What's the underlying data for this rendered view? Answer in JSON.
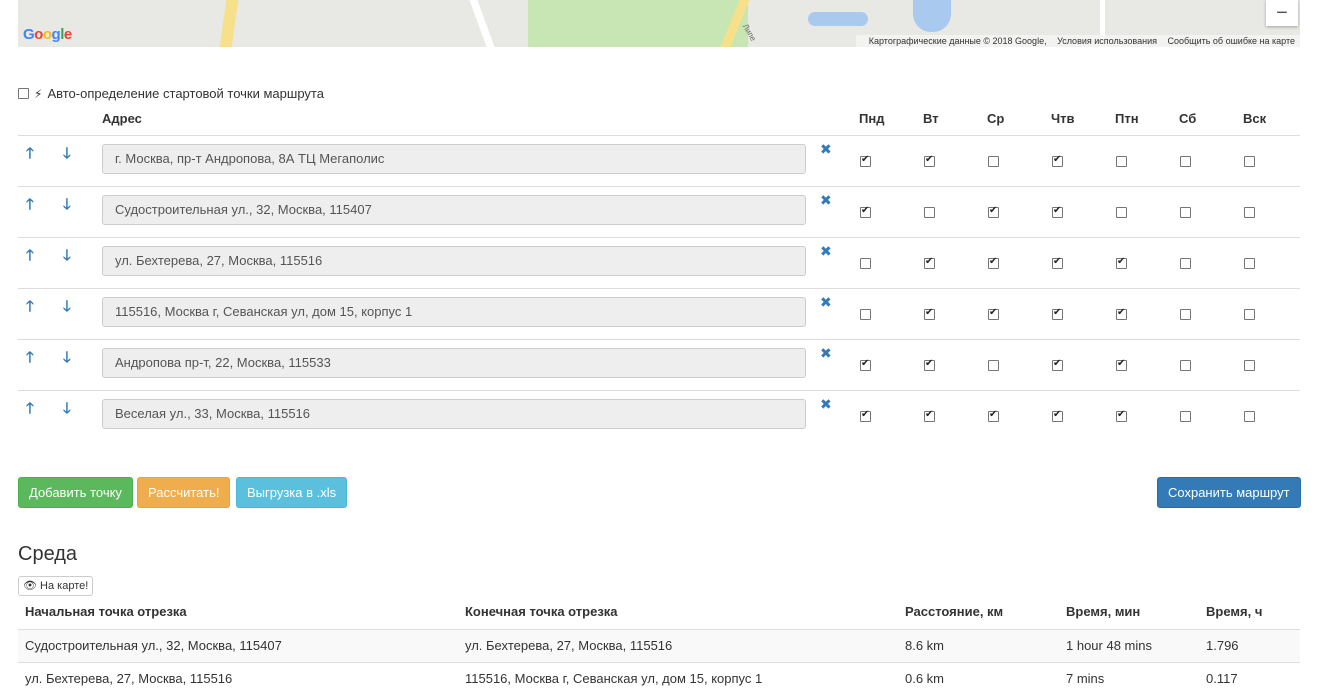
{
  "map": {
    "logo": "Google",
    "attribution": "Картографические данные © 2018 Google",
    "terms": "Условия использования",
    "report": "Сообщить об ошибке на карте",
    "zoom_out": "−",
    "street_label": "Липе"
  },
  "auto_detect": {
    "checked": false,
    "label": "Авто-определение стартовой точки маршрута"
  },
  "table": {
    "address_header": "Адрес",
    "days": [
      "Пнд",
      "Вт",
      "Ср",
      "Чтв",
      "Птн",
      "Сб",
      "Вск"
    ],
    "rows": [
      {
        "address": "г. Москва, пр-т Андропова, 8А ТЦ Мегаполис",
        "days": [
          true,
          true,
          false,
          true,
          false,
          false,
          false
        ]
      },
      {
        "address": "Судостроительная ул., 32, Москва, 115407",
        "days": [
          true,
          false,
          true,
          true,
          false,
          false,
          false
        ]
      },
      {
        "address": "ул. Бехтерева, 27, Москва, 115516",
        "days": [
          false,
          true,
          true,
          true,
          true,
          false,
          false
        ]
      },
      {
        "address": "115516, Москва г, Севанская ул, дом 15, корпус 1",
        "days": [
          false,
          true,
          true,
          true,
          true,
          false,
          false
        ]
      },
      {
        "address": "Андропова пр-т, 22, Москва, 115533",
        "days": [
          true,
          true,
          false,
          true,
          true,
          false,
          false
        ]
      },
      {
        "address": "Веселая ул., 33, Москва, 115516",
        "days": [
          true,
          true,
          true,
          true,
          true,
          false,
          false
        ]
      }
    ]
  },
  "buttons": {
    "add": "Добавить точку",
    "calc": "Рассчитать!",
    "export": "Выгрузка в .xls",
    "save": "Сохранить маршрут"
  },
  "result": {
    "day_title": "Среда",
    "map_button": "На карте!",
    "headers": [
      "Начальная точка отрезка",
      "Конечная точка отрезка",
      "Расстояние, км",
      "Время, мин",
      "Время, ч"
    ],
    "rows": [
      [
        "Судостроительная ул., 32, Москва, 115407",
        "ул. Бехтерева, 27, Москва, 115516",
        "8.6 km",
        "1 hour 48 mins",
        "1.796"
      ],
      [
        "ул. Бехтерева, 27, Москва, 115516",
        "115516, Москва г, Севанская ул, дом 15, корпус 1",
        "0.6 km",
        "7 mins",
        "0.117"
      ]
    ]
  }
}
